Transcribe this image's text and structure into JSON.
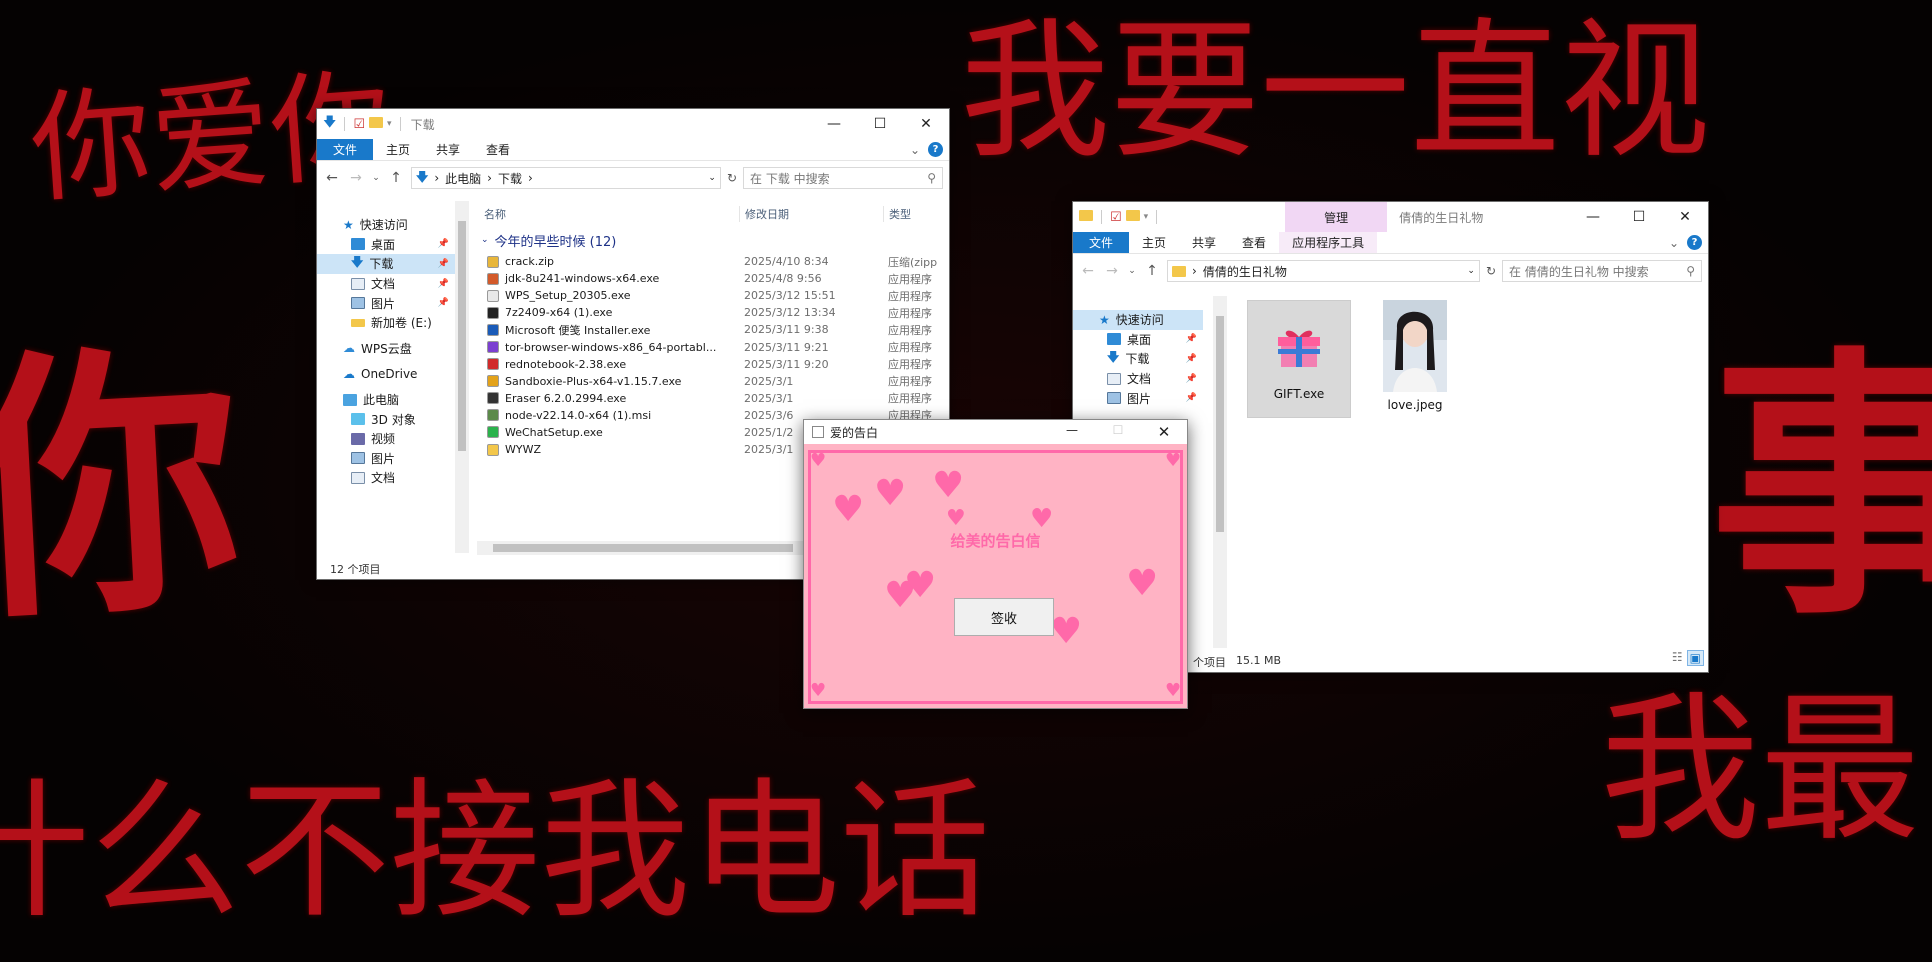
{
  "background": {
    "lines": [
      "你爱你",
      "我要一直视",
      "你",
      "事",
      "我最",
      "什么不接我电话"
    ]
  },
  "explorer1": {
    "window_title": "下载",
    "ribbon_tabs": [
      "文件",
      "主页",
      "共享",
      "查看"
    ],
    "address": {
      "crumbs": [
        "此电脑",
        "下载"
      ]
    },
    "search_placeholder": "在 下载 中搜索",
    "sidebar": [
      {
        "label": "快速访问"
      },
      {
        "label": "桌面"
      },
      {
        "label": "下载"
      },
      {
        "label": "文档"
      },
      {
        "label": "图片"
      },
      {
        "label": "新加卷 (E:)"
      },
      {
        "label": "WPS云盘"
      },
      {
        "label": "OneDrive"
      },
      {
        "label": "此电脑"
      },
      {
        "label": "3D 对象"
      },
      {
        "label": "视频"
      },
      {
        "label": "图片"
      },
      {
        "label": "文档"
      }
    ],
    "columns": [
      "名称",
      "修改日期",
      "类型"
    ],
    "group_label": "今年的早些时候 (12)",
    "files": [
      {
        "name": "crack.zip",
        "date": "2025/4/10 8:34",
        "type": "压缩(zipp",
        "color": "#e8b63a"
      },
      {
        "name": "jdk-8u241-windows-x64.exe",
        "date": "2025/4/8 9:56",
        "type": "应用程序",
        "color": "#d35a2a"
      },
      {
        "name": "WPS_Setup_20305.exe",
        "date": "2025/3/12 15:51",
        "type": "应用程序",
        "color": "#e9e9e9"
      },
      {
        "name": "7z2409-x64 (1).exe",
        "date": "2025/3/12 13:34",
        "type": "应用程序",
        "color": "#222222"
      },
      {
        "name": "Microsoft 便笺 Installer.exe",
        "date": "2025/3/11 9:38",
        "type": "应用程序",
        "color": "#1a5bb8"
      },
      {
        "name": "tor-browser-windows-x86_64-portabl...",
        "date": "2025/3/11 9:21",
        "type": "应用程序",
        "color": "#7b3fd1"
      },
      {
        "name": "rednotebook-2.38.exe",
        "date": "2025/3/11 9:20",
        "type": "应用程序",
        "color": "#d12a2a"
      },
      {
        "name": "Sandboxie-Plus-x64-v1.15.7.exe",
        "date": "2025/3/1",
        "type": "应用程序",
        "color": "#e3a21a"
      },
      {
        "name": "Eraser 6.2.0.2994.exe",
        "date": "2025/3/1",
        "type": "应用程序",
        "color": "#333333"
      },
      {
        "name": "node-v22.14.0-x64 (1).msi",
        "date": "2025/3/6",
        "type": "应用程序",
        "color": "#5c8a4a"
      },
      {
        "name": "WeChatSetup.exe",
        "date": "2025/1/2",
        "type": "应用程序",
        "color": "#2bb24c"
      },
      {
        "name": "WYWZ",
        "date": "2025/3/1",
        "type": "",
        "color": "#f3c74a"
      }
    ],
    "status": "12 个项目"
  },
  "explorer2": {
    "window_title": "倩倩的生日礼物",
    "contextual_tab_group": "管理",
    "ribbon_tabs": [
      "文件",
      "主页",
      "共享",
      "查看",
      "应用程序工具"
    ],
    "address": {
      "crumbs": [
        "倩倩的生日礼物"
      ]
    },
    "search_placeholder": "在 倩倩的生日礼物 中搜索",
    "sidebar": [
      {
        "label": "快速访问"
      },
      {
        "label": "桌面"
      },
      {
        "label": "下载"
      },
      {
        "label": "文档"
      },
      {
        "label": "图片"
      }
    ],
    "files": [
      {
        "name": "GIFT.exe"
      },
      {
        "name": "love.jpeg"
      }
    ],
    "status_count": "个项目",
    "status_size": "15.1 MB"
  },
  "dialog": {
    "title": "爱的告白",
    "heading": "给美的告白信",
    "button": "签收",
    "accent": "#ff69a9",
    "background": "#ffb3c4"
  }
}
